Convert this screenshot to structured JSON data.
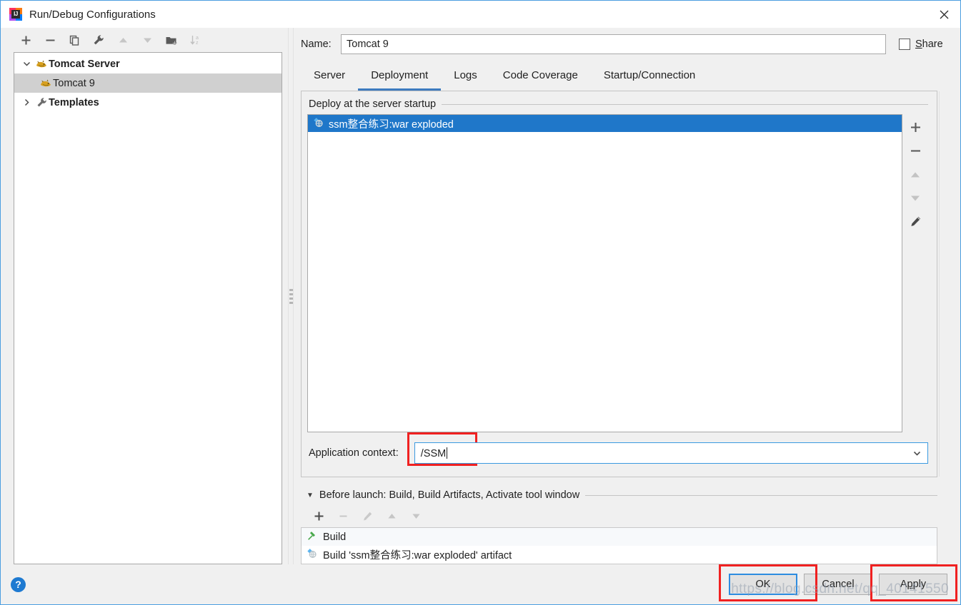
{
  "window": {
    "title": "Run/Debug Configurations",
    "app_icon": "intellij-idea-icon",
    "close_icon": "close-icon"
  },
  "tree_toolbar": {
    "buttons": [
      {
        "name": "add-configuration-button",
        "icon": "plus-icon",
        "enabled": true
      },
      {
        "name": "remove-configuration-button",
        "icon": "minus-icon",
        "enabled": true
      },
      {
        "name": "copy-configuration-button",
        "icon": "copy-icon",
        "enabled": true
      },
      {
        "name": "edit-templates-button",
        "icon": "wrench-icon",
        "enabled": true
      },
      {
        "name": "move-up-button",
        "icon": "arrow-up-icon",
        "enabled": false
      },
      {
        "name": "move-down-button",
        "icon": "arrow-down-icon",
        "enabled": false
      },
      {
        "name": "create-folder-button",
        "icon": "folder-add-icon",
        "enabled": true
      },
      {
        "name": "sort-configurations-button",
        "icon": "sort-az-icon",
        "enabled": false
      }
    ]
  },
  "tree": {
    "nodes": [
      {
        "label": "Tomcat Server",
        "icon": "tomcat-cat-icon",
        "twisty": "chevron-down-icon",
        "level": 0,
        "selected": false,
        "bold": true
      },
      {
        "label": "Tomcat 9",
        "icon": "tomcat-cat-icon",
        "twisty": "",
        "level": 1,
        "selected": true,
        "bold": false
      },
      {
        "label": "Templates",
        "icon": "wrench-icon",
        "twisty": "chevron-right-icon",
        "level": 0,
        "selected": false,
        "bold": true
      }
    ]
  },
  "name_row": {
    "label": "Name:",
    "value": "Tomcat 9",
    "share_label_pre": "",
    "share_label_mnemonic": "S",
    "share_label_post": "hare",
    "share_checked": false
  },
  "tabs": [
    {
      "label": "Server",
      "active": false
    },
    {
      "label": "Deployment",
      "active": true
    },
    {
      "label": "Logs",
      "active": false
    },
    {
      "label": "Code Coverage",
      "active": false
    },
    {
      "label": "Startup/Connection",
      "active": false
    }
  ],
  "deployment": {
    "group_title": "Deploy at the server startup",
    "items": [
      {
        "label": "ssm整合练习:war exploded",
        "icon": "artifact-icon",
        "selected": true
      }
    ],
    "side_buttons": [
      {
        "name": "add-artifact-button",
        "icon": "plus-icon",
        "enabled": true
      },
      {
        "name": "remove-artifact-button",
        "icon": "minus-icon",
        "enabled": true
      },
      {
        "name": "move-artifact-up-button",
        "icon": "arrow-up-icon",
        "enabled": false
      },
      {
        "name": "move-artifact-down-button",
        "icon": "arrow-down-icon",
        "enabled": false
      },
      {
        "name": "edit-artifact-button",
        "icon": "pencil-icon",
        "enabled": true
      }
    ],
    "application_context": {
      "label": "Application context:",
      "value": "/SSM",
      "dropdown_icon": "chevron-down-icon",
      "highlighted": true
    }
  },
  "before_launch": {
    "title": "Before launch: Build, Build Artifacts, Activate tool window",
    "twisty_icon": "triangle-down-icon",
    "toolbar": [
      {
        "name": "add-task-button",
        "icon": "plus-icon",
        "enabled": true
      },
      {
        "name": "remove-task-button",
        "icon": "minus-icon",
        "enabled": false
      },
      {
        "name": "edit-task-button",
        "icon": "pencil-icon",
        "enabled": false
      },
      {
        "name": "task-move-up-button",
        "icon": "arrow-up-icon",
        "enabled": false
      },
      {
        "name": "task-move-down-button",
        "icon": "arrow-down-icon",
        "enabled": false
      }
    ],
    "tasks": [
      {
        "label": "Build",
        "icon": "hammer-icon"
      },
      {
        "label": "Build 'ssm整合练习:war exploded' artifact",
        "icon": "artifact-icon"
      }
    ]
  },
  "footer": {
    "help_icon": "help-question-icon",
    "ok": {
      "label": "OK",
      "focused": true,
      "highlighted": true
    },
    "cancel": {
      "label": "Cancel",
      "focused": false,
      "highlighted": false
    },
    "apply": {
      "label_pre": "A",
      "label_mnemonic": "p",
      "label_post": "ply",
      "label": "Apply",
      "focused": false,
      "highlighted": true
    }
  },
  "watermark": "https://blog.csdn.net/qq_40141550",
  "colors": {
    "selection_blue": "#1f77c9",
    "accent_blue": "#3d7bbf",
    "highlight_red": "#f02121",
    "dialog_bg": "#f0f0f0"
  }
}
